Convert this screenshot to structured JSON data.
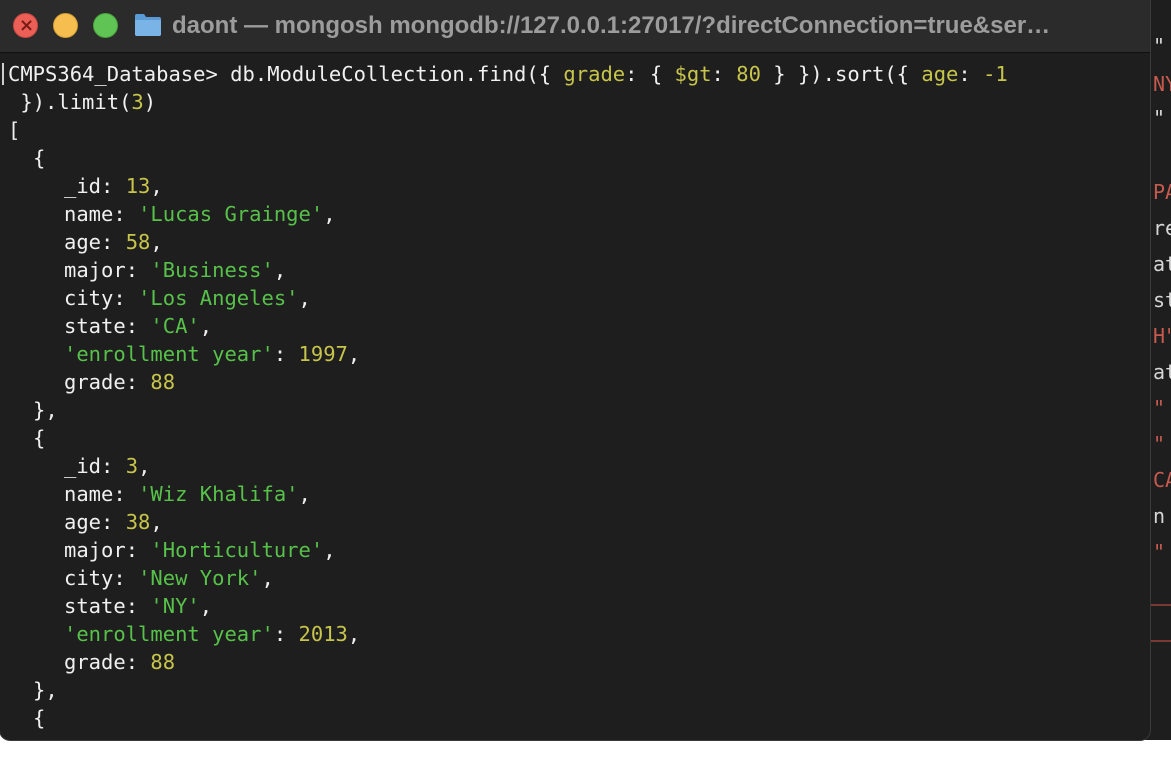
{
  "window": {
    "title": "daont — mongosh mongodb://127.0.0.1:27017/?directConnection=true&ser…",
    "close_symbol": "×"
  },
  "terminal": {
    "prompt": "CMPS364_Database> ",
    "command_part1": "db.ModuleCollection.find({ ",
    "command_grade_key": "grade",
    "command_part2": ": { ",
    "command_gt_key": "$gt",
    "command_part3": ": ",
    "command_gt_value": "80",
    "command_part4": " } }).sort({ ",
    "command_age_key": "age",
    "command_part5": ": ",
    "command_sort_value": "-1",
    "command_cont_part1": " }).limit(",
    "command_limit_value": "3",
    "command_cont_part2": ")",
    "array_open": "[",
    "object_open": "{",
    "object_close": "},",
    "docs": [
      {
        "id": "13",
        "name": "'Lucas Grainge'",
        "age": "58",
        "major": "'Business'",
        "city": "'Los Angeles'",
        "state": "'CA'",
        "enrollment_year": "1997",
        "grade": "88"
      },
      {
        "id": "3",
        "name": "'Wiz Khalifa'",
        "age": "38",
        "major": "'Horticulture'",
        "city": "'New York'",
        "state": "'NY'",
        "enrollment_year": "2013",
        "grade": "88"
      }
    ],
    "keys": {
      "id": "_id",
      "name": "name",
      "age": "age",
      "major": "major",
      "city": "city",
      "state": "state",
      "enrollment_year": "'enrollment year'",
      "grade": "grade",
      "sep": ": ",
      "comma": ","
    }
  },
  "background_window": {
    "lines": [
      "\"",
      "NY",
      "\"",
      " ",
      "PA",
      "re",
      "at",
      "st",
      "H\"",
      "at",
      "\"",
      "\"",
      "CA",
      "n",
      "\""
    ]
  }
}
